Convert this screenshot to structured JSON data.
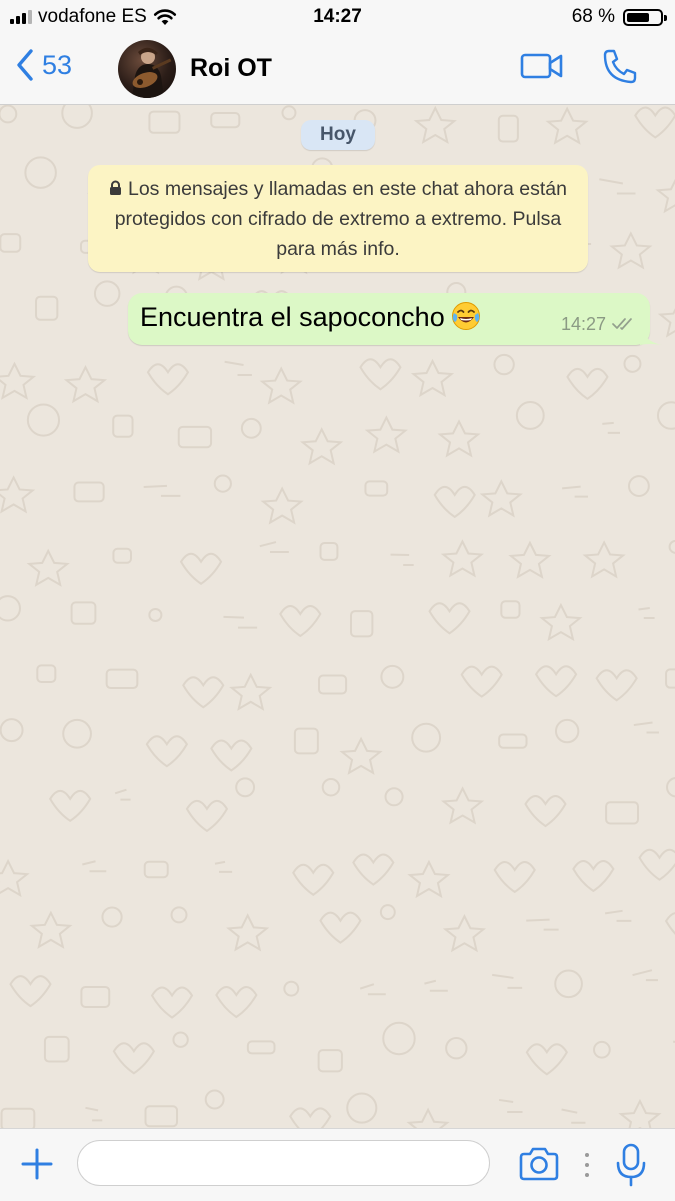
{
  "status_bar": {
    "carrier": "vodafone ES",
    "time": "14:27",
    "battery_text": "68 %",
    "battery_level": 0.68,
    "signal_bars": 4,
    "signal_strength": 3
  },
  "nav": {
    "back_count": "53",
    "contact_name": "Roi OT",
    "icons": [
      "chevron-left-icon",
      "video-call-icon",
      "phone-icon"
    ]
  },
  "chat": {
    "date_label": "Hoy",
    "encryption_notice": "Los mensajes y llamadas en este chat ahora están protegidos con cifrado de extremo a extremo. Pulsa para más info.",
    "messages": [
      {
        "direction": "outgoing",
        "text": "Encuentra el sapoconcho",
        "emoji": "face-with-tears-of-joy",
        "time": "14:27",
        "status": "delivered"
      }
    ]
  },
  "input_bar": {
    "placeholder": "",
    "value": "",
    "icons": [
      "plus-icon",
      "camera-icon",
      "microphone-icon"
    ]
  },
  "colors": {
    "accent": "#2f7fe2",
    "outgoing_bubble": "#dcf8c6",
    "notice_bubble": "#fcf4c4",
    "date_pill": "#d9e6f5",
    "chat_background": "#ece6dd"
  }
}
